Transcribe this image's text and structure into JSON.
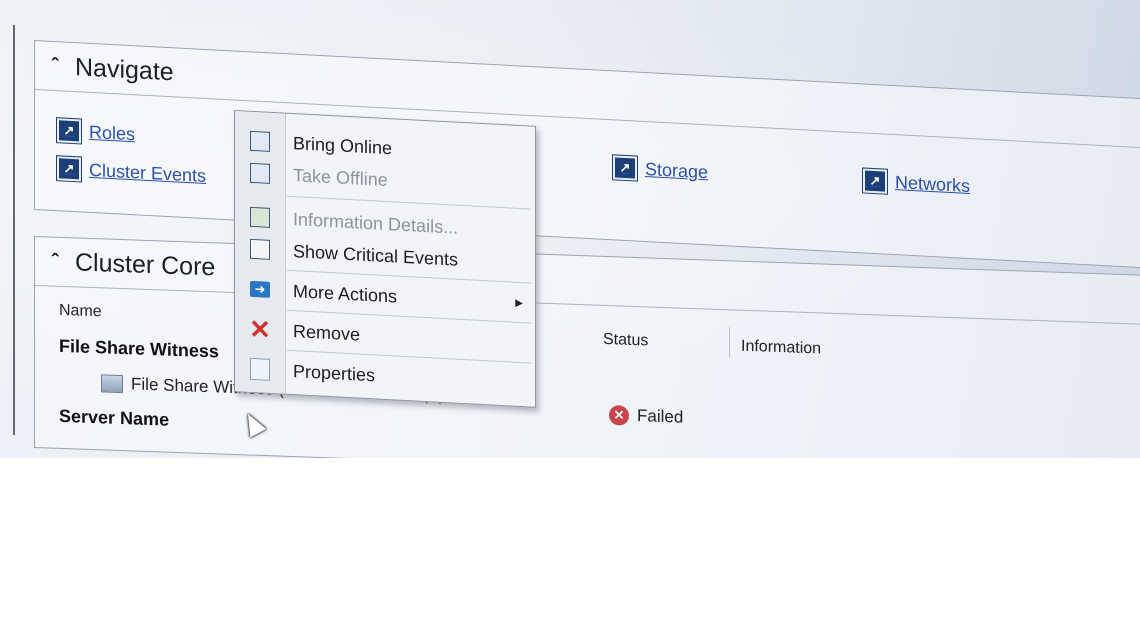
{
  "navigate": {
    "title": "Navigate",
    "links": [
      {
        "label": "Roles",
        "icon": "shortcut-icon"
      },
      {
        "label": "Cluster Events",
        "icon": "shortcut-icon"
      },
      {
        "label": "Storage",
        "icon": "shortcut-icon"
      },
      {
        "label": "Networks",
        "icon": "shortcut-icon"
      }
    ]
  },
  "cluster_core": {
    "title": "Cluster Core",
    "columns": {
      "name": "Name",
      "status": "Status",
      "information": "Information"
    },
    "groups": [
      {
        "label": "File Share Witness"
      },
      {
        "label": "Server Name"
      }
    ],
    "resource": {
      "name": "File Share Witness (\\\\filesrv batch sit sqlquorum)",
      "status": "Failed"
    }
  },
  "context_menu": {
    "items": [
      {
        "label": "Bring Online",
        "enabled": true,
        "icon": "bring-online-icon"
      },
      {
        "label": "Take Offline",
        "enabled": false,
        "icon": "take-offline-icon"
      },
      {
        "label": "Information Details...",
        "enabled": false,
        "icon": "information-details-icon"
      },
      {
        "label": "Show Critical Events",
        "enabled": true,
        "icon": "critical-events-icon"
      },
      {
        "label": "More Actions",
        "enabled": true,
        "icon": "more-actions-icon",
        "submenu": true
      },
      {
        "label": "Remove",
        "enabled": true,
        "icon": "remove-icon"
      },
      {
        "label": "Properties",
        "enabled": true,
        "icon": "properties-icon"
      }
    ]
  },
  "colors": {
    "link": "#2a4fb0",
    "failed": "#c9444d",
    "remove": "#d2322d"
  }
}
